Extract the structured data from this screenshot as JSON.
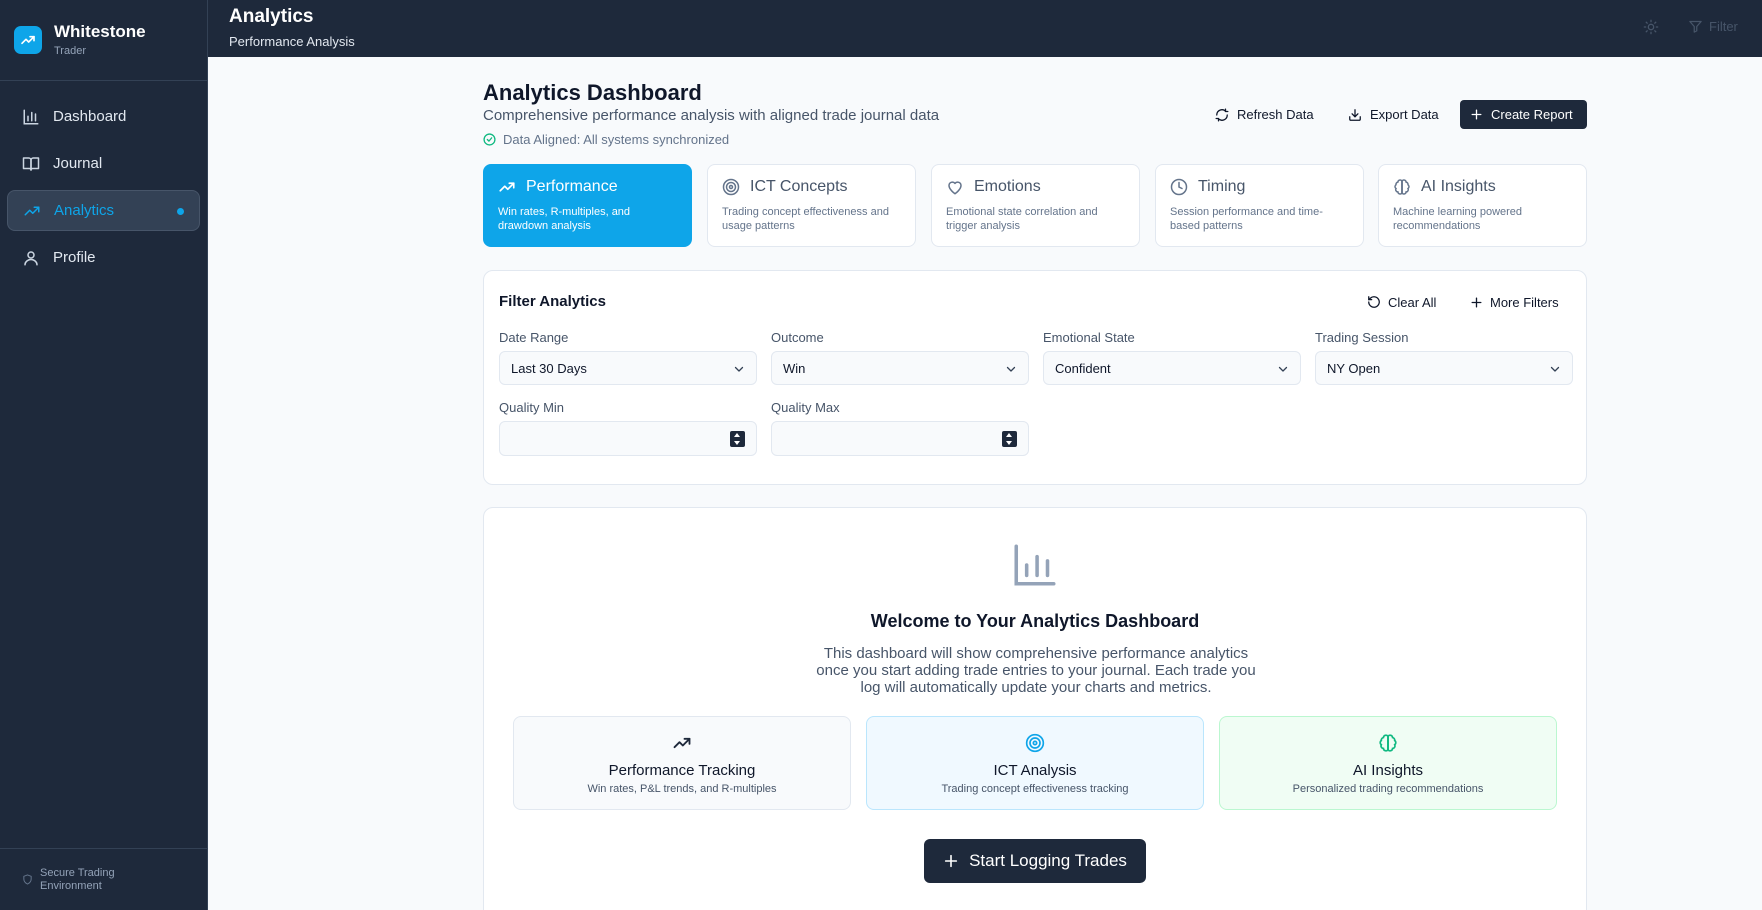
{
  "brand": {
    "name": "Whitestone",
    "subtitle": "Trader"
  },
  "sidebar": {
    "items": [
      {
        "label": "Dashboard",
        "icon": "bar-chart-icon"
      },
      {
        "label": "Journal",
        "icon": "book-open-icon"
      },
      {
        "label": "Analytics",
        "icon": "trending-up-icon",
        "active": true
      },
      {
        "label": "Profile",
        "icon": "user-icon"
      }
    ],
    "footer": {
      "line1": "Secure Trading",
      "line2": "Environment",
      "icon": "shield-icon"
    }
  },
  "topbar": {
    "title": "Analytics",
    "subtitle": "Performance Analysis",
    "filter_label": "Filter",
    "theme_icon": "sun-icon"
  },
  "header": {
    "title": "Analytics Dashboard",
    "description": "Comprehensive performance analysis with aligned trade journal data",
    "status": "Data Aligned: All systems synchronized",
    "refresh_label": "Refresh Data",
    "export_label": "Export Data",
    "create_label": "Create Report"
  },
  "tabs": [
    {
      "label": "Performance",
      "description": "Win rates, R-multiples, and drawdown analysis",
      "icon": "trending-up-icon",
      "active": true
    },
    {
      "label": "ICT Concepts",
      "description": "Trading concept effectiveness and usage patterns",
      "icon": "target-icon"
    },
    {
      "label": "Emotions",
      "description": "Emotional state correlation and trigger analysis",
      "icon": "heart-icon"
    },
    {
      "label": "Timing",
      "description": "Session performance and time-based patterns",
      "icon": "clock-icon"
    },
    {
      "label": "AI Insights",
      "description": "Machine learning powered recommendations",
      "icon": "brain-icon"
    }
  ],
  "filters": {
    "title": "Filter Analytics",
    "clear_label": "Clear All",
    "more_label": "More Filters",
    "date_range": {
      "label": "Date Range",
      "value": "Last 30 Days"
    },
    "outcome": {
      "label": "Outcome",
      "value": "Win"
    },
    "emotional_state": {
      "label": "Emotional State",
      "value": "Confident"
    },
    "trading_session": {
      "label": "Trading Session",
      "value": "NY Open"
    },
    "quality_min": {
      "label": "Quality Min",
      "value": ""
    },
    "quality_max": {
      "label": "Quality Max",
      "value": ""
    }
  },
  "welcome": {
    "title": "Welcome to Your Analytics Dashboard",
    "text": "This dashboard will show comprehensive performance analytics once you start adding trade entries to your journal. Each trade you log will automatically update your charts and metrics.",
    "features": [
      {
        "title": "Performance Tracking",
        "description": "Win rates, P&L trends, and R-multiples",
        "icon": "trending-up-icon"
      },
      {
        "title": "ICT Analysis",
        "description": "Trading concept effectiveness tracking",
        "icon": "target-icon"
      },
      {
        "title": "AI Insights",
        "description": "Personalized trading recommendations",
        "icon": "brain-icon"
      }
    ],
    "cta_label": "Start Logging Trades"
  },
  "colors": {
    "accent": "#0ea5e9",
    "sidebar_bg": "#1e293b",
    "dark_button": "#1e293b",
    "page_bg": "#f8fafc",
    "success": "#10b981"
  }
}
